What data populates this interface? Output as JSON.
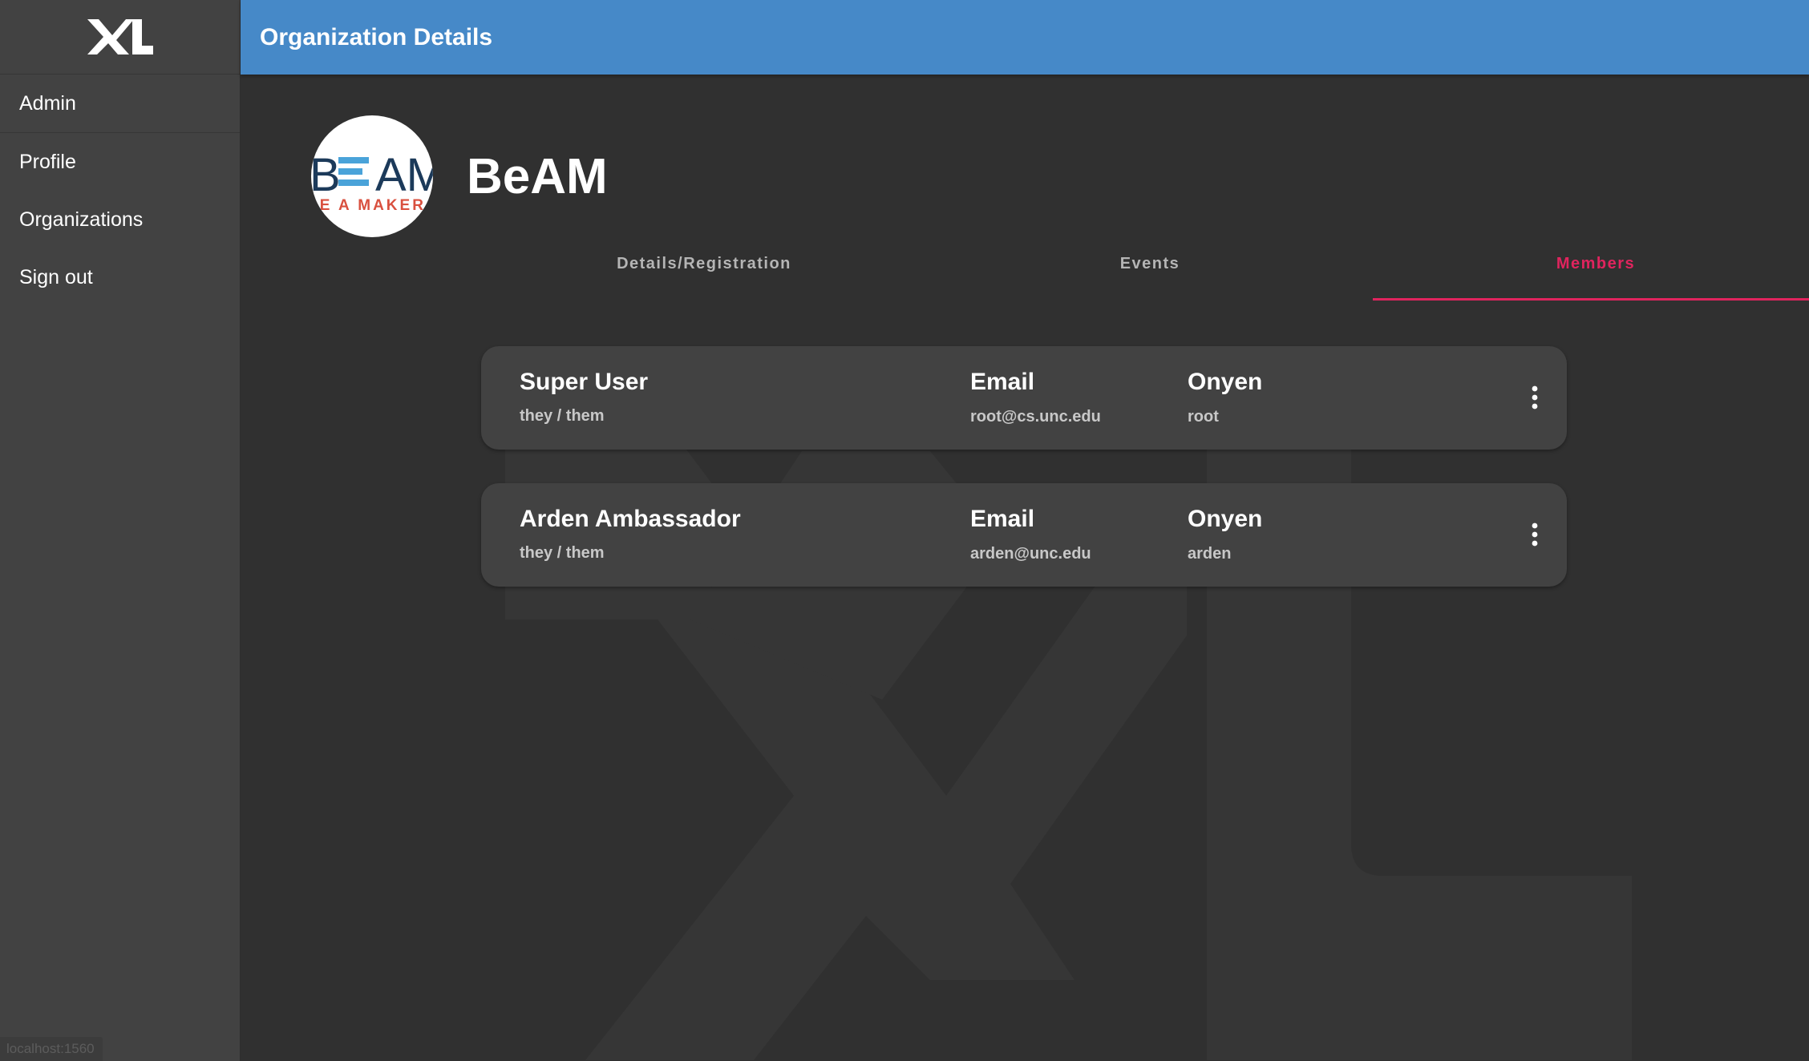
{
  "sidebar": {
    "logo_icon": "xl-logo-icon",
    "items": [
      {
        "label": "Admin"
      },
      {
        "label": "Profile"
      },
      {
        "label": "Organizations"
      },
      {
        "label": "Sign out"
      }
    ],
    "status_url": "localhost:1560"
  },
  "header": {
    "title": "Organization Details",
    "color": "#4689c8"
  },
  "organization": {
    "name": "BeAM",
    "logo": {
      "word": "BEAM",
      "tagline": "BE A MAKER"
    }
  },
  "tabs": [
    {
      "label": "Details/Registration",
      "active": false
    },
    {
      "label": "Events",
      "active": false
    },
    {
      "label": "Members",
      "active": true
    }
  ],
  "members": [
    {
      "name": "Super User",
      "pronouns": "they / them",
      "email_label": "Email",
      "email": "root@cs.unc.edu",
      "onyen_label": "Onyen",
      "onyen": "root",
      "menu_icon": "more-vert-icon"
    },
    {
      "name": "Arden Ambassador",
      "pronouns": "they / them",
      "email_label": "Email",
      "email": "arden@unc.edu",
      "onyen_label": "Onyen",
      "onyen": "arden",
      "menu_icon": "more-vert-icon"
    }
  ],
  "colors": {
    "accent": "#e0245e",
    "background": "#303030",
    "sidebar": "#424242",
    "card": "#424242"
  }
}
